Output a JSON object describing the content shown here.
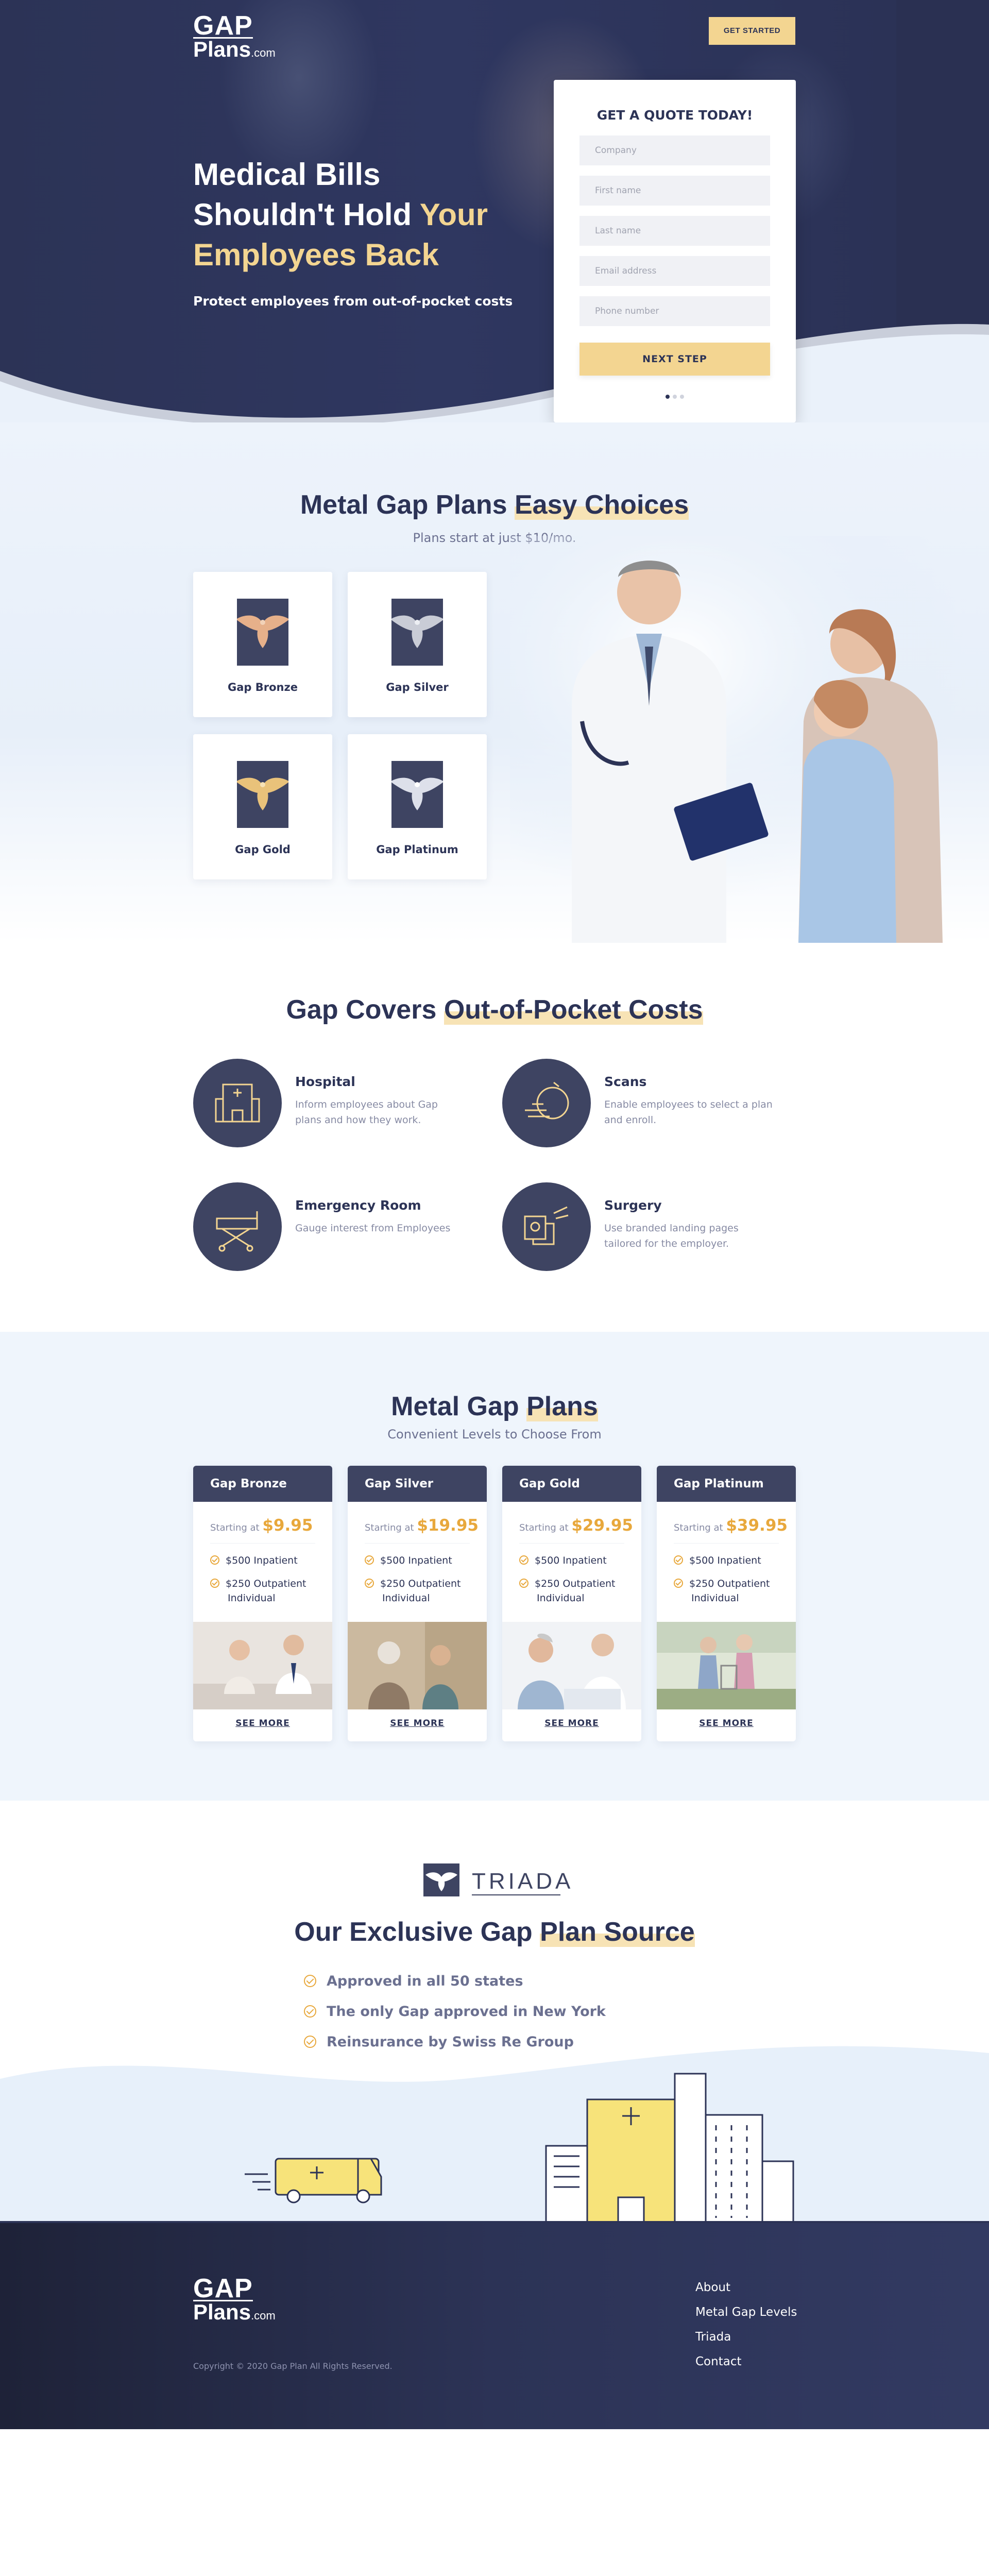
{
  "header": {
    "logo_main": "GAP",
    "logo_sub": "Plans",
    "logo_suffix": ".com",
    "cta_label": "GET STARTED"
  },
  "hero": {
    "title_line1": "Medical Bills",
    "title_line2a": "Shouldn't Hold ",
    "title_line2b": "Your",
    "title_line3": "Employees Back",
    "subtitle": "Protect employees from out-of-pocket costs"
  },
  "quote_form": {
    "title": "GET A QUOTE TODAY!",
    "fields": {
      "company": "Company",
      "first_name": "First name",
      "last_name": "Last name",
      "email": "Email address",
      "phone": "Phone number"
    },
    "submit_label": "NEXT STEP",
    "step_indicator": "1 of 3"
  },
  "easy_choices": {
    "title_plain": "Metal Gap Plans ",
    "title_bold": "Easy Choices",
    "subtitle": "Plans start at just $10/mo.",
    "tiles": [
      {
        "label": "Gap Bronze",
        "color": "#e6b08a"
      },
      {
        "label": "Gap Silver",
        "color": "#c9ccd6"
      },
      {
        "label": "Gap Gold",
        "color": "#e9c27a"
      },
      {
        "label": "Gap Platinum",
        "color": "#dde0ea"
      }
    ]
  },
  "coverage": {
    "title_plain": "Gap Covers ",
    "title_bold": "Out-of-Pocket Costs",
    "items": [
      {
        "title": "Hospital",
        "desc": "Inform employees about Gap plans and how they work.",
        "icon": "hospital-icon"
      },
      {
        "title": "Scans",
        "desc": "Enable employees to select a plan and enroll.",
        "icon": "scan-icon"
      },
      {
        "title": "Emergency Room",
        "desc": "Gauge interest from Employees",
        "icon": "stretcher-icon"
      },
      {
        "title": "Surgery",
        "desc": "Use branded landing pages tailored for the employer.",
        "icon": "surgery-icon"
      }
    ]
  },
  "plans": {
    "title_plain": "Metal Gap ",
    "title_bold": "Plans",
    "subtitle": "Convenient Levels to Choose From",
    "starting_label": "Starting at ",
    "see_more": "SEE MORE",
    "cards": [
      {
        "name": "Gap Bronze",
        "price": "$9.95",
        "f1": "$500 Inpatient",
        "f2a": "$250 Outpatient",
        "f2b": "Individual"
      },
      {
        "name": "Gap Silver",
        "price": "$19.95",
        "f1": "$500 Inpatient",
        "f2a": "$250 Outpatient",
        "f2b": "Individual"
      },
      {
        "name": "Gap Gold",
        "price": "$29.95",
        "f1": "$500 Inpatient",
        "f2a": "$250 Outpatient",
        "f2b": "Individual"
      },
      {
        "name": "Gap Platinum",
        "price": "$39.95",
        "f1": "$500 Inpatient",
        "f2a": "$250 Outpatient",
        "f2b": "Individual"
      }
    ]
  },
  "source": {
    "brand": "TRIADA",
    "title_plain": "Our Exclusive Gap ",
    "title_bold": "Plan Source",
    "bullets": [
      "Approved in all 50 states",
      "The only Gap approved in New York",
      "Reinsurance by Swiss Re Group"
    ]
  },
  "footer": {
    "copyright": "Copyright © 2020 Gap Plan All Rights Reserved.",
    "links": [
      "About",
      "Metal Gap Levels",
      "Triada",
      "Contact"
    ]
  },
  "colors": {
    "navy": "#2c3356",
    "slate": "#3e4462",
    "gold": "#f3d591",
    "accent": "#e8a83c",
    "light_bg": "#eff5fc"
  }
}
